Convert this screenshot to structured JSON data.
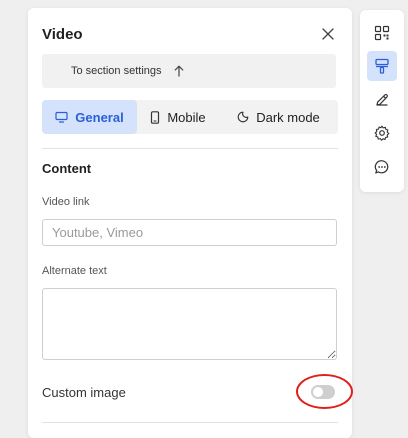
{
  "panel": {
    "title": "Video",
    "section_link_label": "To section settings"
  },
  "tabs": [
    {
      "label": "General",
      "icon": "monitor-icon",
      "active": true
    },
    {
      "label": "Mobile",
      "icon": "phone-icon",
      "active": false
    },
    {
      "label": "Dark mode",
      "icon": "moon-icon",
      "active": false
    }
  ],
  "content": {
    "heading": "Content",
    "video_link_label": "Video link",
    "video_link_placeholder": "Youtube, Vimeo",
    "video_link_value": "",
    "alt_text_label": "Alternate text",
    "alt_text_value": "",
    "custom_image_label": "Custom image",
    "custom_image_enabled": false
  },
  "toolbar": {
    "items": [
      {
        "icon": "qr-grid-icon",
        "active": false
      },
      {
        "icon": "paint-roller-icon",
        "active": true
      },
      {
        "icon": "pencil-icon",
        "active": false
      },
      {
        "icon": "gear-icon",
        "active": false
      },
      {
        "icon": "chat-bubble-icon",
        "active": false
      }
    ]
  },
  "colors": {
    "accent": "#2b5fd9",
    "accent_bg": "#d5e2fb",
    "highlight": "#e0201b"
  }
}
